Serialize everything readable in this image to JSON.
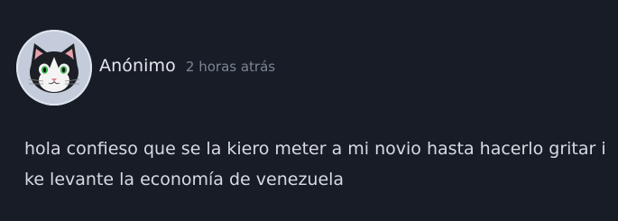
{
  "post": {
    "author": "Anónimo",
    "time": "2 horas atrás",
    "message": "hola confieso que se la kiero meter a mi novio hasta hacerlo gritar i ke levante la economía de venezuela",
    "avatar_icon": "cat-avatar-icon"
  },
  "colors": {
    "background": "#171c26",
    "author_text": "#e4e7ec",
    "time_text": "#7c8595",
    "message_text": "#d7dbe1",
    "avatar_bg": "#c4ccdb"
  }
}
